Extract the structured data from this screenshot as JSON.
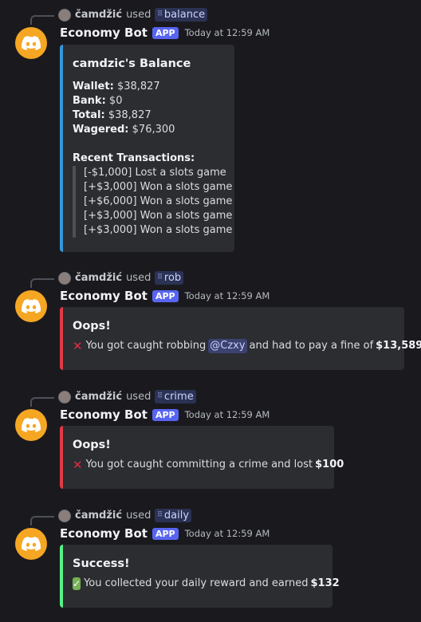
{
  "user": "čamdžić",
  "used_text": "used",
  "bot": {
    "name": "Economy Bot",
    "tag": "APP",
    "time": "Today at 12:59 AM"
  },
  "messages": [
    {
      "command": "balance",
      "title": "camdzic's Balance",
      "fields": [
        {
          "label": "Wallet:",
          "value": "$38,827"
        },
        {
          "label": "Bank:",
          "value": "$0"
        },
        {
          "label": "Total:",
          "value": "$38,827"
        },
        {
          "label": "Wagered:",
          "value": "$76,300"
        }
      ],
      "recent_label": "Recent Transactions:",
      "transactions": [
        "[-$1,000] Lost a slots game",
        "[+$3,000] Won a slots game",
        "[+$6,000] Won a slots game",
        "[+$3,000] Won a slots game",
        "[+$3,000] Won a slots game"
      ],
      "accent": "#3498db"
    },
    {
      "command": "rob",
      "title": "Oops!",
      "desc_pre": "You got caught robbing",
      "mention": "@Czxy",
      "desc_mid": "and had to pay a fine of",
      "amount": "$13,589",
      "accent": "#e03b45"
    },
    {
      "command": "crime",
      "title": "Oops!",
      "desc_pre": "You got caught committing a crime and lost",
      "amount": "$100",
      "accent": "#e03b45"
    },
    {
      "command": "daily",
      "title": "Success!",
      "desc_pre": "You collected your daily reward and earned",
      "amount": "$132",
      "accent": "#57f287"
    }
  ],
  "icons": {
    "avatar": "discord-logo-icon",
    "fail": "red-x-icon",
    "success": "green-check-icon",
    "command": "slash-command-icon"
  }
}
